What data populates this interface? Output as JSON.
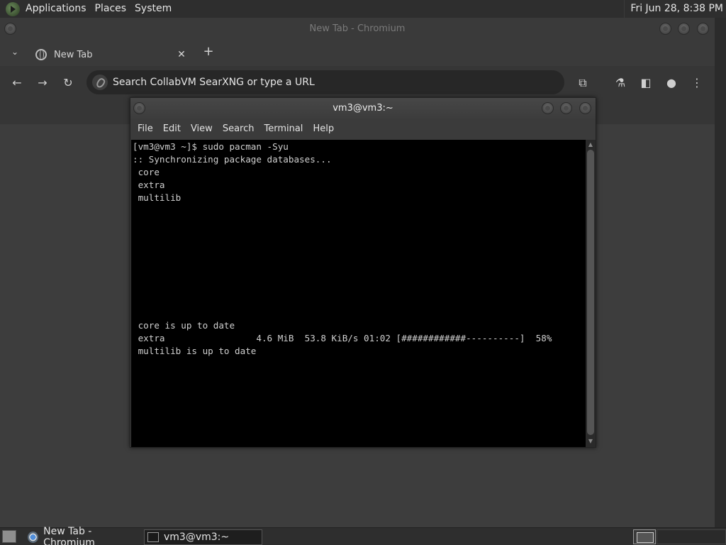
{
  "top_panel": {
    "menus": [
      "Applications",
      "Places",
      "System"
    ],
    "clock": "Fri Jun 28,  8:38 PM"
  },
  "chromium": {
    "window_title": "New Tab - Chromium",
    "tab_title": "New Tab",
    "tab_close": "✕",
    "new_tab": "+",
    "tab_list": "⌄",
    "omnibox_placeholder": "Search CollabVM SearXNG or type a URL",
    "icons": {
      "back": "←",
      "forward": "→",
      "reload": "↻",
      "extensions": "⧉",
      "labs": "⚗",
      "side_panel": "◧",
      "profile": "●",
      "menu": "⋮"
    }
  },
  "terminal": {
    "window_title": "vm3@vm3:~",
    "menu": [
      "File",
      "Edit",
      "View",
      "Search",
      "Terminal",
      "Help"
    ],
    "lines": [
      "[vm3@vm3 ~]$ sudo pacman -Syu",
      ":: Synchronizing package databases...",
      " core",
      " extra",
      " multilib",
      "",
      "",
      "",
      "",
      "",
      "",
      "",
      "",
      "",
      " core is up to date",
      " extra                 4.6 MiB  53.8 KiB/s 01:02 [############----------]  58%",
      " multilib is up to date"
    ]
  },
  "taskbar": {
    "items": [
      "New Tab - Chromium",
      "vm3@vm3:~"
    ]
  }
}
